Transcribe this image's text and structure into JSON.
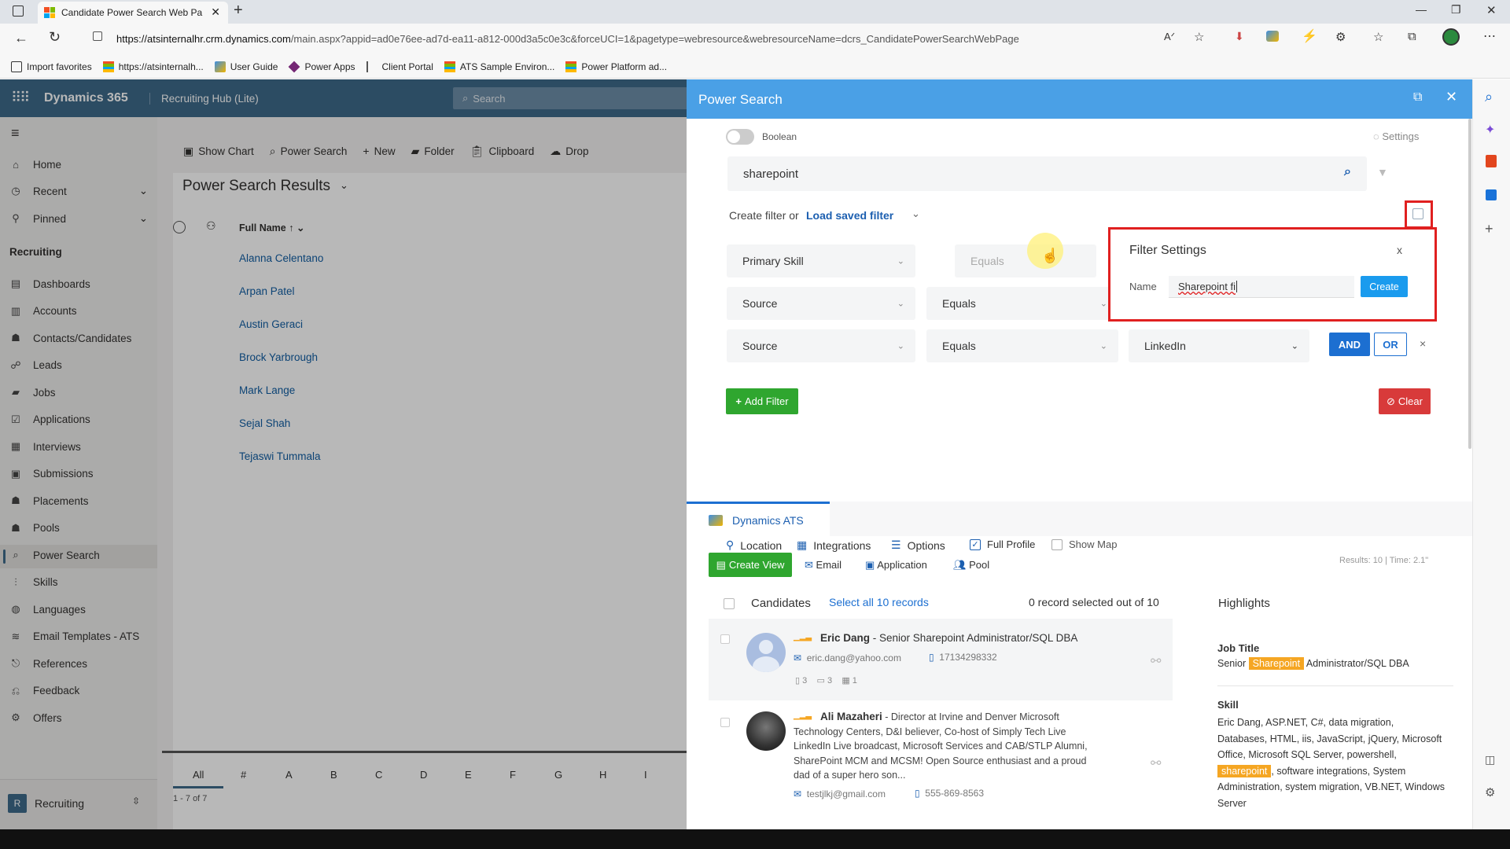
{
  "browser": {
    "tab_title": "Candidate Power Search Web Pa",
    "url_domain": "https://atsinternalhr.crm.dynamics.com",
    "url_path": "/main.aspx?appid=ad0e76ee-ad7d-ea11-a812-000d3a5c0e3c&forceUCI=1&pagetype=webresource&webresourceName=dcrs_CandidatePowerSearchWebPage",
    "bookmarks": [
      "Import favorites",
      "https://atsinternalh...",
      "User Guide",
      "Power Apps",
      "Client Portal",
      "ATS Sample Environ...",
      "Power Platform ad..."
    ]
  },
  "app": {
    "product": "Dynamics 365",
    "app_name": "Recruiting Hub (Lite)",
    "search_placeholder": "Search"
  },
  "nav": {
    "top_items": [
      "Home",
      "Recent",
      "Pinned"
    ],
    "section": "Recruiting",
    "items": [
      "Dashboards",
      "Accounts",
      "Contacts/Candidates",
      "Leads",
      "Jobs",
      "Applications",
      "Interviews",
      "Submissions",
      "Placements",
      "Pools",
      "Power Search",
      "Skills",
      "Languages",
      "Email Templates - ATS",
      "References",
      "Feedback",
      "Offers"
    ],
    "selected": "Power Search",
    "area_badge": "R",
    "area_label": "Recruiting"
  },
  "commandbar": [
    "Show Chart",
    "Power Search",
    "New",
    "Folder",
    "Clipboard",
    "Drop"
  ],
  "view": {
    "title": "Power Search Results",
    "column": "Full Name",
    "sort_marker": "↑",
    "names": [
      "Alanna Celentano",
      "Arpan Patel",
      "Austin Geraci",
      "Brock Yarbrough",
      "Mark Lange",
      "Sejal Shah",
      "Tejaswi Tummala"
    ],
    "alphabet": [
      "All",
      "#",
      "A",
      "B",
      "C",
      "D",
      "E",
      "F",
      "G",
      "H",
      "I"
    ],
    "footer": "1 - 7 of 7"
  },
  "power_search": {
    "title": "Power Search",
    "boolean_label": "Boolean",
    "settings_label": "Settings",
    "query": "sharepoint",
    "create_filter_text": "Create filter or",
    "load_saved_filter": "Load saved filter",
    "filters": [
      {
        "field": "Primary Skill",
        "op": "Equals",
        "value": ""
      },
      {
        "field": "Source",
        "op": "Equals",
        "value": ""
      },
      {
        "field": "Source",
        "op": "Equals",
        "value": "LinkedIn"
      }
    ],
    "and_label": "AND",
    "or_label": "OR",
    "remove_glyph": "×",
    "add_filter": "Add Filter",
    "clear": "Clear",
    "options": [
      "Location",
      "Integrations",
      "Options",
      "Full Profile",
      "Show Map"
    ],
    "full_profile_checked": true,
    "show_map_checked": false
  },
  "filter_settings": {
    "title": "Filter Settings",
    "close_glyph": "x",
    "name_label": "Name",
    "name_value": "Sharepoint fi",
    "create_label": "Create"
  },
  "results": {
    "tab": "Dynamics ATS",
    "create_view": "Create View",
    "email": "Email",
    "application": "Application",
    "pool": "Pool",
    "stats": "Results: 10  |  Time: 2.1\"",
    "candidates_label": "Candidates",
    "select_all": "Select all 10 records",
    "selected_count": "0 record selected out of 10",
    "highlights_label": "Highlights",
    "candidates": [
      {
        "name": "Eric Dang",
        "headline": " - Senior Sharepoint Administrator/SQL DBA",
        "email": "eric.dang@yahoo.com",
        "phone": "17134298332",
        "docs": "3",
        "apps": "3",
        "events": "1"
      },
      {
        "name": "Ali Mazaheri",
        "headline": " - Director at Irvine and Denver Microsoft Technology Centers, D&I believer, Co-host of Simply Tech Live LinkedIn Live broadcast, Microsoft Services and CAB/STLP Alumni, SharePoint MCM and MCSM! Open Source enthusiast and a proud dad of a super hero son...",
        "email": "testjlkj@gmail.com",
        "phone": "555-869-8563"
      }
    ],
    "highlights": {
      "job_title_label": "Job Title",
      "job_title_pre": "Senior",
      "job_title_hl": "Sharepoint",
      "job_title_post": "Administrator/SQL DBA",
      "skill_label": "Skill",
      "skill_pre": "Eric Dang, ASP.NET, C#, data migration, Databases, HTML, iis, JavaScript, jQuery, Microsoft Office, Microsoft SQL Server, powershell,",
      "skill_hl": "sharepoint",
      "skill_post": ", software integrations, System Administration, system migration, VB.NET, Windows Server"
    }
  },
  "colors": {
    "panel_header": "#4aa0e6",
    "d365_header": "#3d6a8a",
    "add_filter": "#2fa62f",
    "clear": "#d83a3a",
    "highlight": "#f5a623",
    "annotation_box": "#e02020"
  }
}
